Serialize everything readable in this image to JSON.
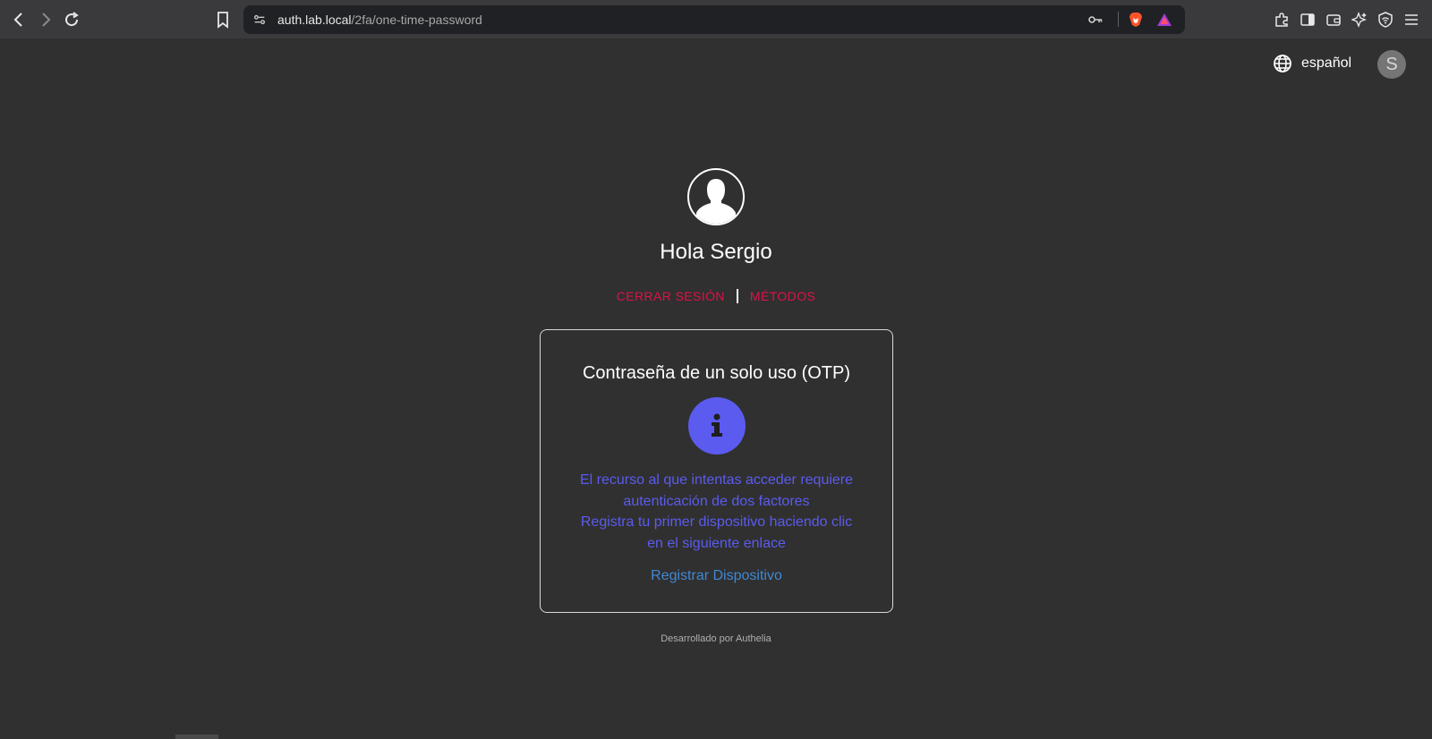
{
  "browser": {
    "url_host": "auth.lab.local",
    "url_path": "/2fa/one-time-password"
  },
  "header": {
    "language_label": "español",
    "avatar_letter": "S"
  },
  "main": {
    "greeting": "Hola Sergio",
    "logout_label": "CERRAR SESIÓN",
    "methods_label": "MÉTODOS"
  },
  "card": {
    "title": "Contraseña de un solo uso (OTP)",
    "message_lines": [
      "El recurso al que intentas acceder requiere",
      "autenticación de dos factores",
      "Registra tu primer dispositivo haciendo clic",
      "en el siguiente enlace"
    ],
    "register_label": "Registrar Dispositivo"
  },
  "footer": {
    "powered_by": "Desarrollado por Authelia"
  },
  "colors": {
    "background": "#303030",
    "accent_red": "#e0104a",
    "info_purple": "#5b5bf0",
    "link_blue": "#3f88d4"
  }
}
